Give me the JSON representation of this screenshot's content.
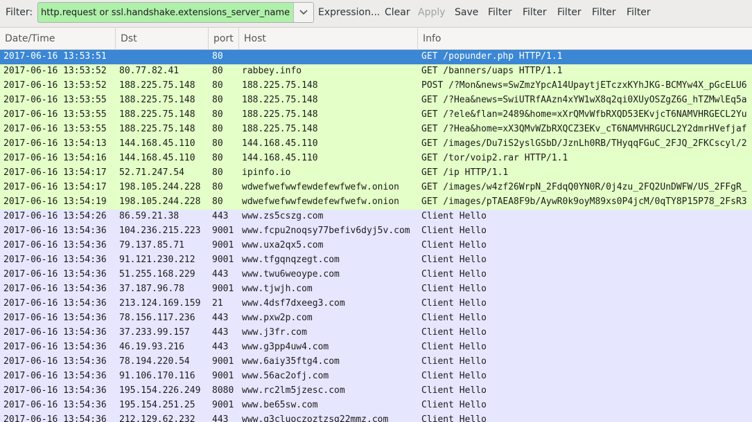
{
  "toolbar": {
    "filter_label": "Filter:",
    "filter_value": "http.request or ssl.handshake.extensions_server_name",
    "buttons": [
      "Expression...",
      "Clear",
      "Apply",
      "Save",
      "Filter",
      "Filter",
      "Filter",
      "Filter",
      "Filter"
    ],
    "disabled_buttons": [
      "Apply"
    ]
  },
  "columns": [
    "Date/Time",
    "Dst",
    "port",
    "Host",
    "Info"
  ],
  "colors": {
    "filter_valid": "#aff0ab",
    "http_row": "#e4ffc7",
    "tls_row": "#e7e6ff",
    "selected_row": "#3b87d4"
  },
  "rows": [
    {
      "kind": "http",
      "selected": true,
      "date": "2017-06-16 13:53:51",
      "dst": "",
      "port": "80",
      "host": "",
      "info": "GET /popunder.php HTTP/1.1"
    },
    {
      "kind": "http",
      "date": "2017-06-16 13:53:52",
      "dst": "80.77.82.41",
      "port": "80",
      "host": "rabbey.info",
      "info": "GET /banners/uaps HTTP/1.1"
    },
    {
      "kind": "http",
      "date": "2017-06-16 13:53:52",
      "dst": "188.225.75.148",
      "port": "80",
      "host": "188.225.75.148",
      "info": "POST /?Mon&news=SwZmzYpcA14UpaytjETczxKYhJKG-BCMYw4X_pGcELU6"
    },
    {
      "kind": "http",
      "date": "2017-06-16 13:53:55",
      "dst": "188.225.75.148",
      "port": "80",
      "host": "188.225.75.148",
      "info": "GET /?Hea&news=SwiUTRfAAzn4xYW1wX8q2qi0XUyOSZgZ6G_hTZMwlEq5a"
    },
    {
      "kind": "http",
      "date": "2017-06-16 13:53:55",
      "dst": "188.225.75.148",
      "port": "80",
      "host": "188.225.75.148",
      "info": "GET /?ele&flan=2489&home=xXrQMvWfbRXQD53EKvjcT6NAMVHRGECL2Yu"
    },
    {
      "kind": "http",
      "date": "2017-06-16 13:53:55",
      "dst": "188.225.75.148",
      "port": "80",
      "host": "188.225.75.148",
      "info": "GET /?Hea&home=xX3QMvWZbRXQCZ3EKv_cT6NAMVHRGUCL2Y2dmrHVefjaf"
    },
    {
      "kind": "http",
      "date": "2017-06-16 13:54:13",
      "dst": "144.168.45.110",
      "port": "80",
      "host": "144.168.45.110",
      "info": "GET /images/Du7iS2yslGSbD/JznLh0RB/THyqqFGuC_2FJQ_2FKCscyl/2"
    },
    {
      "kind": "http",
      "date": "2017-06-16 13:54:16",
      "dst": "144.168.45.110",
      "port": "80",
      "host": "144.168.45.110",
      "info": "GET /tor/voip2.rar HTTP/1.1"
    },
    {
      "kind": "http",
      "date": "2017-06-16 13:54:17",
      "dst": "52.71.247.54",
      "port": "80",
      "host": "ipinfo.io",
      "info": "GET /ip HTTP/1.1"
    },
    {
      "kind": "http",
      "date": "2017-06-16 13:54:17",
      "dst": "198.105.244.228",
      "port": "80",
      "host": "wdwefwefwwfewdefewfwefw.onion",
      "info": "GET /images/w4zf26WrpN_2FdqQ0YN0R/0j4zu_2FQ2UnDWFW/US_2FFgR_"
    },
    {
      "kind": "http",
      "date": "2017-06-16 13:54:19",
      "dst": "198.105.244.228",
      "port": "80",
      "host": "wdwefwefwwfewdefewfwefw.onion",
      "info": "GET /images/pTAEA8F9b/AywR0k9oyM89xs0P4jcM/0qTY8P15P78_2FsR3"
    },
    {
      "kind": "tls",
      "date": "2017-06-16 13:54:26",
      "dst": "86.59.21.38",
      "port": "443",
      "host": "www.zs5cszg.com",
      "info": "Client Hello"
    },
    {
      "kind": "tls",
      "date": "2017-06-16 13:54:36",
      "dst": "104.236.215.223",
      "port": "9001",
      "host": "www.fcpu2noqsy77befiv6dyj5v.com",
      "info": "Client Hello"
    },
    {
      "kind": "tls",
      "date": "2017-06-16 13:54:36",
      "dst": "79.137.85.71",
      "port": "9001",
      "host": "www.uxa2qx5.com",
      "info": "Client Hello"
    },
    {
      "kind": "tls",
      "date": "2017-06-16 13:54:36",
      "dst": "91.121.230.212",
      "port": "9001",
      "host": "www.tfgqnqzegt.com",
      "info": "Client Hello"
    },
    {
      "kind": "tls",
      "date": "2017-06-16 13:54:36",
      "dst": "51.255.168.229",
      "port": "443",
      "host": "www.twu6weoype.com",
      "info": "Client Hello"
    },
    {
      "kind": "tls",
      "date": "2017-06-16 13:54:36",
      "dst": "37.187.96.78",
      "port": "9001",
      "host": "www.tjwjh.com",
      "info": "Client Hello"
    },
    {
      "kind": "tls",
      "date": "2017-06-16 13:54:36",
      "dst": "213.124.169.159",
      "port": "21",
      "host": "www.4dsf7dxeeg3.com",
      "info": "Client Hello"
    },
    {
      "kind": "tls",
      "date": "2017-06-16 13:54:36",
      "dst": "78.156.117.236",
      "port": "443",
      "host": "www.pxw2p.com",
      "info": "Client Hello"
    },
    {
      "kind": "tls",
      "date": "2017-06-16 13:54:36",
      "dst": "37.233.99.157",
      "port": "443",
      "host": "www.j3fr.com",
      "info": "Client Hello"
    },
    {
      "kind": "tls",
      "date": "2017-06-16 13:54:36",
      "dst": "46.19.93.216",
      "port": "443",
      "host": "www.g3pp4uw4.com",
      "info": "Client Hello"
    },
    {
      "kind": "tls",
      "date": "2017-06-16 13:54:36",
      "dst": "78.194.220.54",
      "port": "9001",
      "host": "www.6aiy35ftg4.com",
      "info": "Client Hello"
    },
    {
      "kind": "tls",
      "date": "2017-06-16 13:54:36",
      "dst": "91.106.170.116",
      "port": "9001",
      "host": "www.56ac2ofj.com",
      "info": "Client Hello"
    },
    {
      "kind": "tls",
      "date": "2017-06-16 13:54:36",
      "dst": "195.154.226.249",
      "port": "8080",
      "host": "www.rc2lm5jzesc.com",
      "info": "Client Hello"
    },
    {
      "kind": "tls",
      "date": "2017-06-16 13:54:36",
      "dst": "195.154.251.25",
      "port": "9001",
      "host": "www.be65sw.com",
      "info": "Client Hello"
    },
    {
      "kind": "tls",
      "date": "2017-06-16 13:54:36",
      "dst": "212.129.62.232",
      "port": "443",
      "host": "www.g3cluoczoztzsg22mmz.com",
      "info": "Client Hello"
    }
  ]
}
